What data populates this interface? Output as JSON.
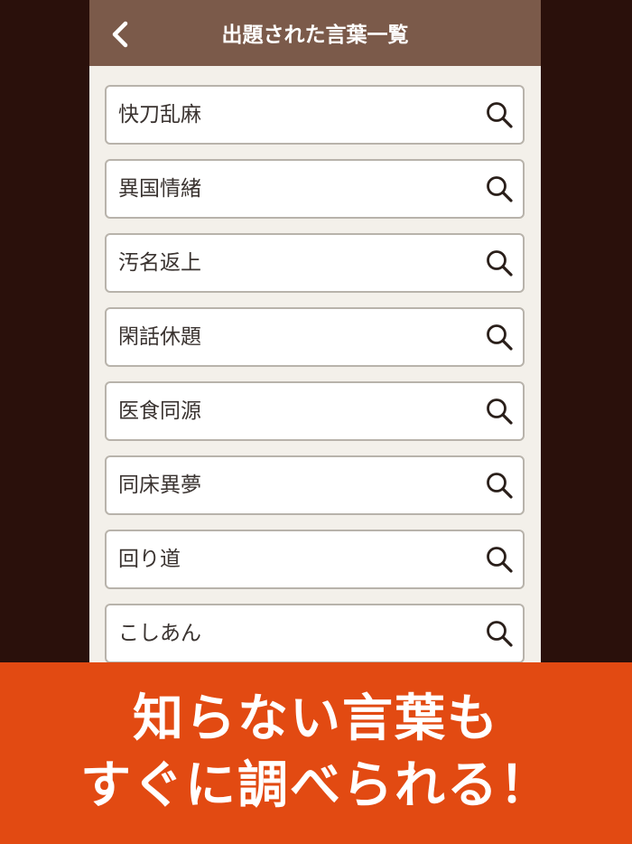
{
  "navbar": {
    "title": "出題された言葉一覧",
    "back_icon": "chevron-left-icon"
  },
  "words": [
    {
      "label": "快刀乱麻",
      "icon": "search-icon"
    },
    {
      "label": "異国情緒",
      "icon": "search-icon"
    },
    {
      "label": "汚名返上",
      "icon": "search-icon"
    },
    {
      "label": "閑話休題",
      "icon": "search-icon"
    },
    {
      "label": "医食同源",
      "icon": "search-icon"
    },
    {
      "label": "同床異夢",
      "icon": "search-icon"
    },
    {
      "label": "回り道",
      "icon": "search-icon"
    },
    {
      "label": "こしあん",
      "icon": "search-icon"
    }
  ],
  "banner": {
    "line1": "知らない言葉も",
    "line2": "すぐに調べられる！"
  },
  "colors": {
    "outer_background": "#2a100b",
    "navbar": "#7b5a4a",
    "screen_background": "#f3f0ea",
    "banner": "#e24a12",
    "text": "#3a3330"
  }
}
